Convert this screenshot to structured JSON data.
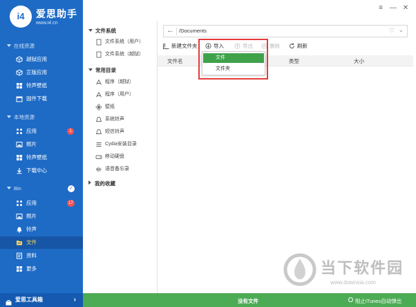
{
  "app": {
    "name": "爱思助手",
    "url": "www.i4.cn"
  },
  "colors": {
    "sidebar": "#1E6BC6",
    "active_text": "#FFD75A",
    "badge": "#F05454",
    "status_bar": "#4CAB55",
    "dropdown_selected": "#3FA24B",
    "highlight": "#E53A3A"
  },
  "sidebar": {
    "sections": [
      {
        "label": "在线资源",
        "items": [
          {
            "label": "越狱应用",
            "icon": "cube-icon"
          },
          {
            "label": "正版应用",
            "icon": "cube-icon"
          },
          {
            "label": "铃声壁纸",
            "icon": "bell-icon"
          },
          {
            "label": "固件下载",
            "icon": "box-icon"
          }
        ]
      },
      {
        "label": "本地资源",
        "items": [
          {
            "label": "应用",
            "icon": "app-icon",
            "badge": "1"
          },
          {
            "label": "照片",
            "icon": "photo-icon"
          },
          {
            "label": "铃声壁纸",
            "icon": "bell-icon"
          },
          {
            "label": "下载中心",
            "icon": "download-icon"
          }
        ]
      },
      {
        "label": "Bin",
        "items": [
          {
            "label": "应用",
            "icon": "app-icon",
            "badge": "17"
          },
          {
            "label": "照片",
            "icon": "photo-icon"
          },
          {
            "label": "铃声",
            "icon": "bell-icon"
          },
          {
            "label": "文件",
            "icon": "folder-icon",
            "active": true
          },
          {
            "label": "资料",
            "icon": "list-icon"
          },
          {
            "label": "更多",
            "icon": "more-icon"
          }
        ]
      }
    ],
    "bottom": {
      "label": "爱思工具箱",
      "arrow": "›"
    }
  },
  "tree": {
    "file_system": {
      "label": "文件系统",
      "items": [
        "文件系统（用户）",
        "文件系统（越狱）"
      ]
    },
    "common_dirs": {
      "label": "常用目录",
      "items": [
        "程序（越狱）",
        "程序（用户）",
        "壁纸",
        "系统铃声",
        "短信铃声",
        "Cydia安装目录",
        "移动硬盘",
        "语音备忘录"
      ]
    },
    "favorites": {
      "label": "我的收藏"
    }
  },
  "window_controls": {
    "menu": "≡",
    "minimize": "—",
    "close": "✕"
  },
  "pathbar": {
    "back": "←",
    "path": "/Documents",
    "heart": "♡",
    "chevron": "⌄"
  },
  "toolbar": {
    "new_folder": "新建文件夹",
    "import": "导入",
    "export": "导出",
    "delete": "删除",
    "refresh": "刷新"
  },
  "table": {
    "columns": [
      "文件名",
      "类型",
      "大小"
    ]
  },
  "dropdown": {
    "items": [
      "文件",
      "文件夹"
    ],
    "selected": 0
  },
  "status": {
    "center": "没有文件",
    "right": "阻止iTunes自动弹出"
  },
  "watermark": {
    "title": "当下软件园",
    "url": "www.downxia.com"
  }
}
